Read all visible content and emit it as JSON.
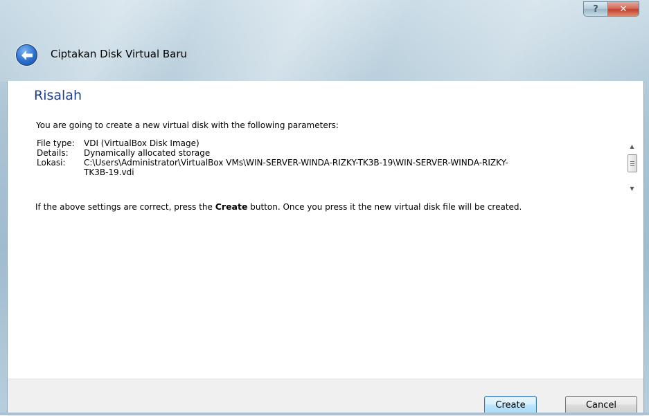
{
  "window": {
    "title": "Ciptakan Disk Virtual Baru",
    "help_glyph": "?",
    "close_glyph": "✕"
  },
  "page": {
    "heading": "Risalah",
    "intro": "You are going to create a new virtual disk with the following parameters:",
    "params": [
      {
        "key": "File type:",
        "value": "VDI (VirtualBox Disk Image)"
      },
      {
        "key": "Details:",
        "value": "Dynamically allocated storage"
      },
      {
        "key": "Lokasi:",
        "value": "C:\\Users\\Administrator\\VirtualBox VMs\\WIN-SERVER-WINDA-RIZKY-TK3B-19\\WIN-SERVER-WINDA-RIZKY-"
      },
      {
        "key": "",
        "value": "TK3B-19.vdi"
      }
    ],
    "note_before": "If the above settings are correct, press the ",
    "note_bold": "Create",
    "note_after": " button. Once you press it the new virtual disk file will be created."
  },
  "buttons": {
    "create": "Create",
    "cancel": "Cancel"
  },
  "colors": {
    "heading": "#1c3d8f",
    "accent": "#3c7fb1"
  },
  "icons": [
    "back-arrow-icon",
    "help-icon",
    "close-icon",
    "scroll-up-icon",
    "scroll-down-icon"
  ]
}
